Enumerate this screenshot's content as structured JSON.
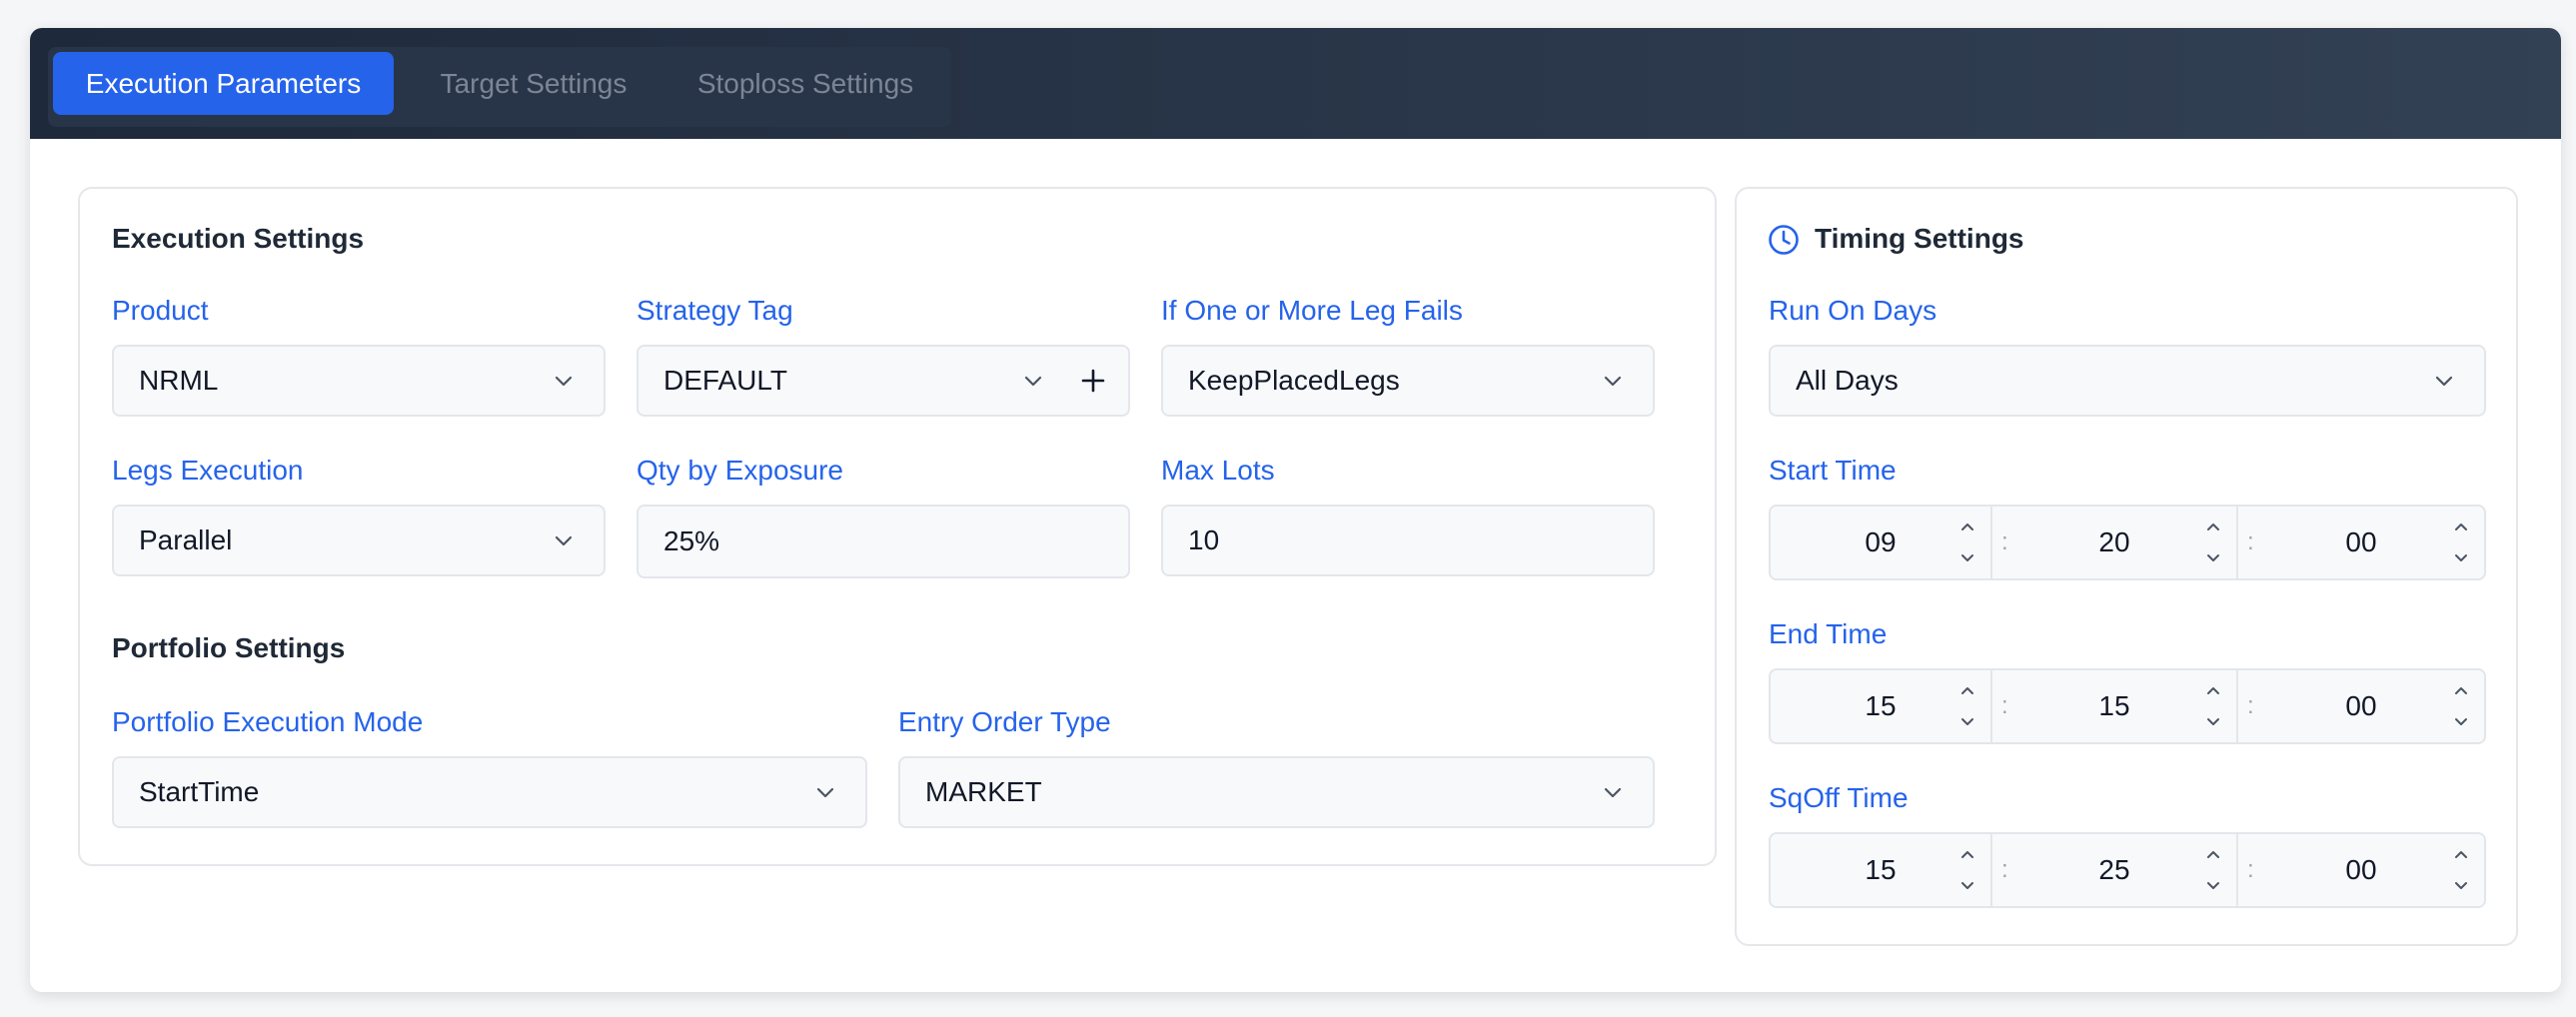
{
  "tabs": [
    {
      "label": "Execution Parameters",
      "active": true
    },
    {
      "label": "Target Settings",
      "active": false
    },
    {
      "label": "Stoploss Settings",
      "active": false
    }
  ],
  "execution": {
    "title": "Execution Settings",
    "product": {
      "label": "Product",
      "value": "NRML"
    },
    "strategy_tag": {
      "label": "Strategy Tag",
      "value": "DEFAULT"
    },
    "leg_fail": {
      "label": "If One or More Leg Fails",
      "value": "KeepPlacedLegs"
    },
    "legs_execution": {
      "label": "Legs Execution",
      "value": "Parallel"
    },
    "qty_exposure": {
      "label": "Qty by Exposure",
      "value": "25%"
    },
    "max_lots": {
      "label": "Max Lots",
      "value": "10"
    }
  },
  "portfolio": {
    "title": "Portfolio Settings",
    "mode": {
      "label": "Portfolio Execution Mode",
      "value": "StartTime"
    },
    "entry_order": {
      "label": "Entry Order Type",
      "value": "MARKET"
    }
  },
  "timing": {
    "title": "Timing Settings",
    "icon": "clock-icon",
    "run_on_days": {
      "label": "Run On Days",
      "value": "All Days"
    },
    "start": {
      "label": "Start Time",
      "h": "09",
      "m": "20",
      "s": "00"
    },
    "end": {
      "label": "End Time",
      "h": "15",
      "m": "15",
      "s": "00"
    },
    "sqoff": {
      "label": "SqOff Time",
      "h": "15",
      "m": "25",
      "s": "00"
    },
    "separator": ":"
  },
  "colors": {
    "accent": "#2563eb",
    "header_dark": "#1e293b",
    "label_blue": "#2563eb"
  }
}
